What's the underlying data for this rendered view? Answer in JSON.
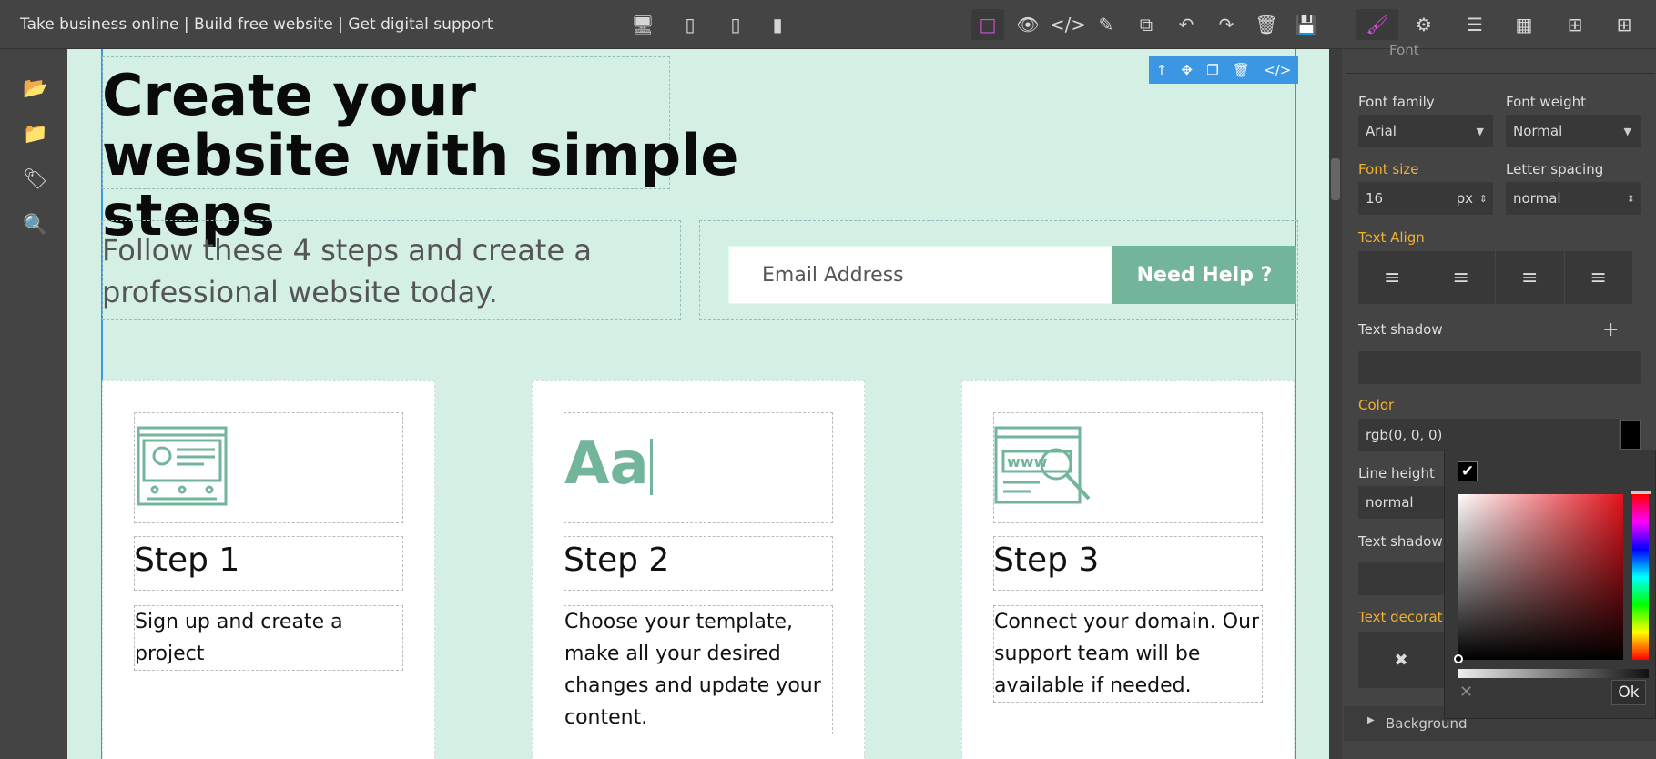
{
  "topbar": {
    "title": "Take business online | Build free website | Get digital support"
  },
  "canvas": {
    "hero_title": "Create your website with simple steps",
    "subtitle": "Follow these 4 steps and create a professional website today.",
    "email_placeholder": "Email Address",
    "help_button": "Need Help ?",
    "cards": [
      {
        "icon_text": "",
        "step": "Step 1",
        "desc": "Sign up and create a project"
      },
      {
        "icon_text": "Aa",
        "step": "Step 2",
        "desc": "Choose your template, make all your desired changes and update your content."
      },
      {
        "icon_text": "",
        "step": "Step 3",
        "desc": "Connect your domain. Our support team will be available if needed."
      }
    ]
  },
  "panel": {
    "section_top": "Font",
    "font_family_label": "Font family",
    "font_family_value": "Arial",
    "font_weight_label": "Font weight",
    "font_weight_value": "Normal",
    "font_size_label": "Font size",
    "font_size_value": "16",
    "font_size_unit": "px",
    "letter_spacing_label": "Letter spacing",
    "letter_spacing_value": "normal",
    "text_align_label": "Text Align",
    "text_shadow_label": "Text shadow",
    "color_label": "Color",
    "color_value": "rgb(0, 0, 0)",
    "line_height_label": "Line height",
    "line_height_value": "normal",
    "text_shadow2_label": "Text shadow",
    "text_decoration_label": "Text decoratio",
    "background_label": "Background",
    "ok_label": "Ok"
  },
  "colors": {
    "accent_green": "#72b59b",
    "canvas_bg": "#d4efe4",
    "select_blue": "#3b97e3",
    "orange_label": "#f0b030"
  }
}
